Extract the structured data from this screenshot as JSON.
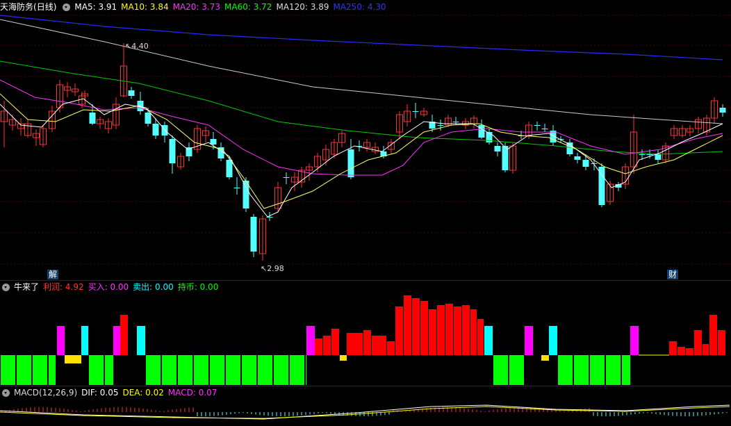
{
  "main": {
    "stock_name": "天海防务",
    "period": "(日线)",
    "ma": [
      {
        "label": "MA5: ",
        "value": "3.91",
        "color": "#ffffff"
      },
      {
        "label": "MA10: ",
        "value": "3.84",
        "color": "#ffff00"
      },
      {
        "label": "MA20: ",
        "value": "3.73",
        "color": "#ff33ff"
      },
      {
        "label": "MA60: ",
        "value": "3.72",
        "color": "#00ff00"
      },
      {
        "label": "MA120: ",
        "value": "3.89",
        "color": "#dddddd"
      },
      {
        "label": "MA250: ",
        "value": "4.30",
        "color": "#3333ff"
      }
    ],
    "high_label": "4.40",
    "low_label": "2.98",
    "marker_left": "解",
    "marker_right": "财"
  },
  "indicator": {
    "name": "牛来了",
    "items": [
      {
        "label": "利润: ",
        "value": "4.92",
        "color": "#ff3333"
      },
      {
        "label": "买入: ",
        "value": "0.00",
        "color": "#ff33ff"
      },
      {
        "label": "卖出: ",
        "value": "0.00",
        "color": "#00ffff"
      },
      {
        "label": "持币: ",
        "value": "0.00",
        "color": "#00ff00"
      }
    ]
  },
  "macd": {
    "name": "MACD(12,26,9)",
    "items": [
      {
        "label": "DIF: ",
        "value": "0.05",
        "color": "#ffffff"
      },
      {
        "label": "DEA: ",
        "value": "0.02",
        "color": "#ffff00"
      },
      {
        "label": "MACD: ",
        "value": "0.07",
        "color": "#ff33ff"
      }
    ]
  },
  "colors": {
    "up": "#ff3333",
    "down": "#54ffff",
    "grid": "#3a0000",
    "profit": "#ff0000",
    "hold": "#00ff00",
    "buy": "#ff00ff",
    "sell": "#00ffff",
    "neutral": "#ffe000"
  }
}
